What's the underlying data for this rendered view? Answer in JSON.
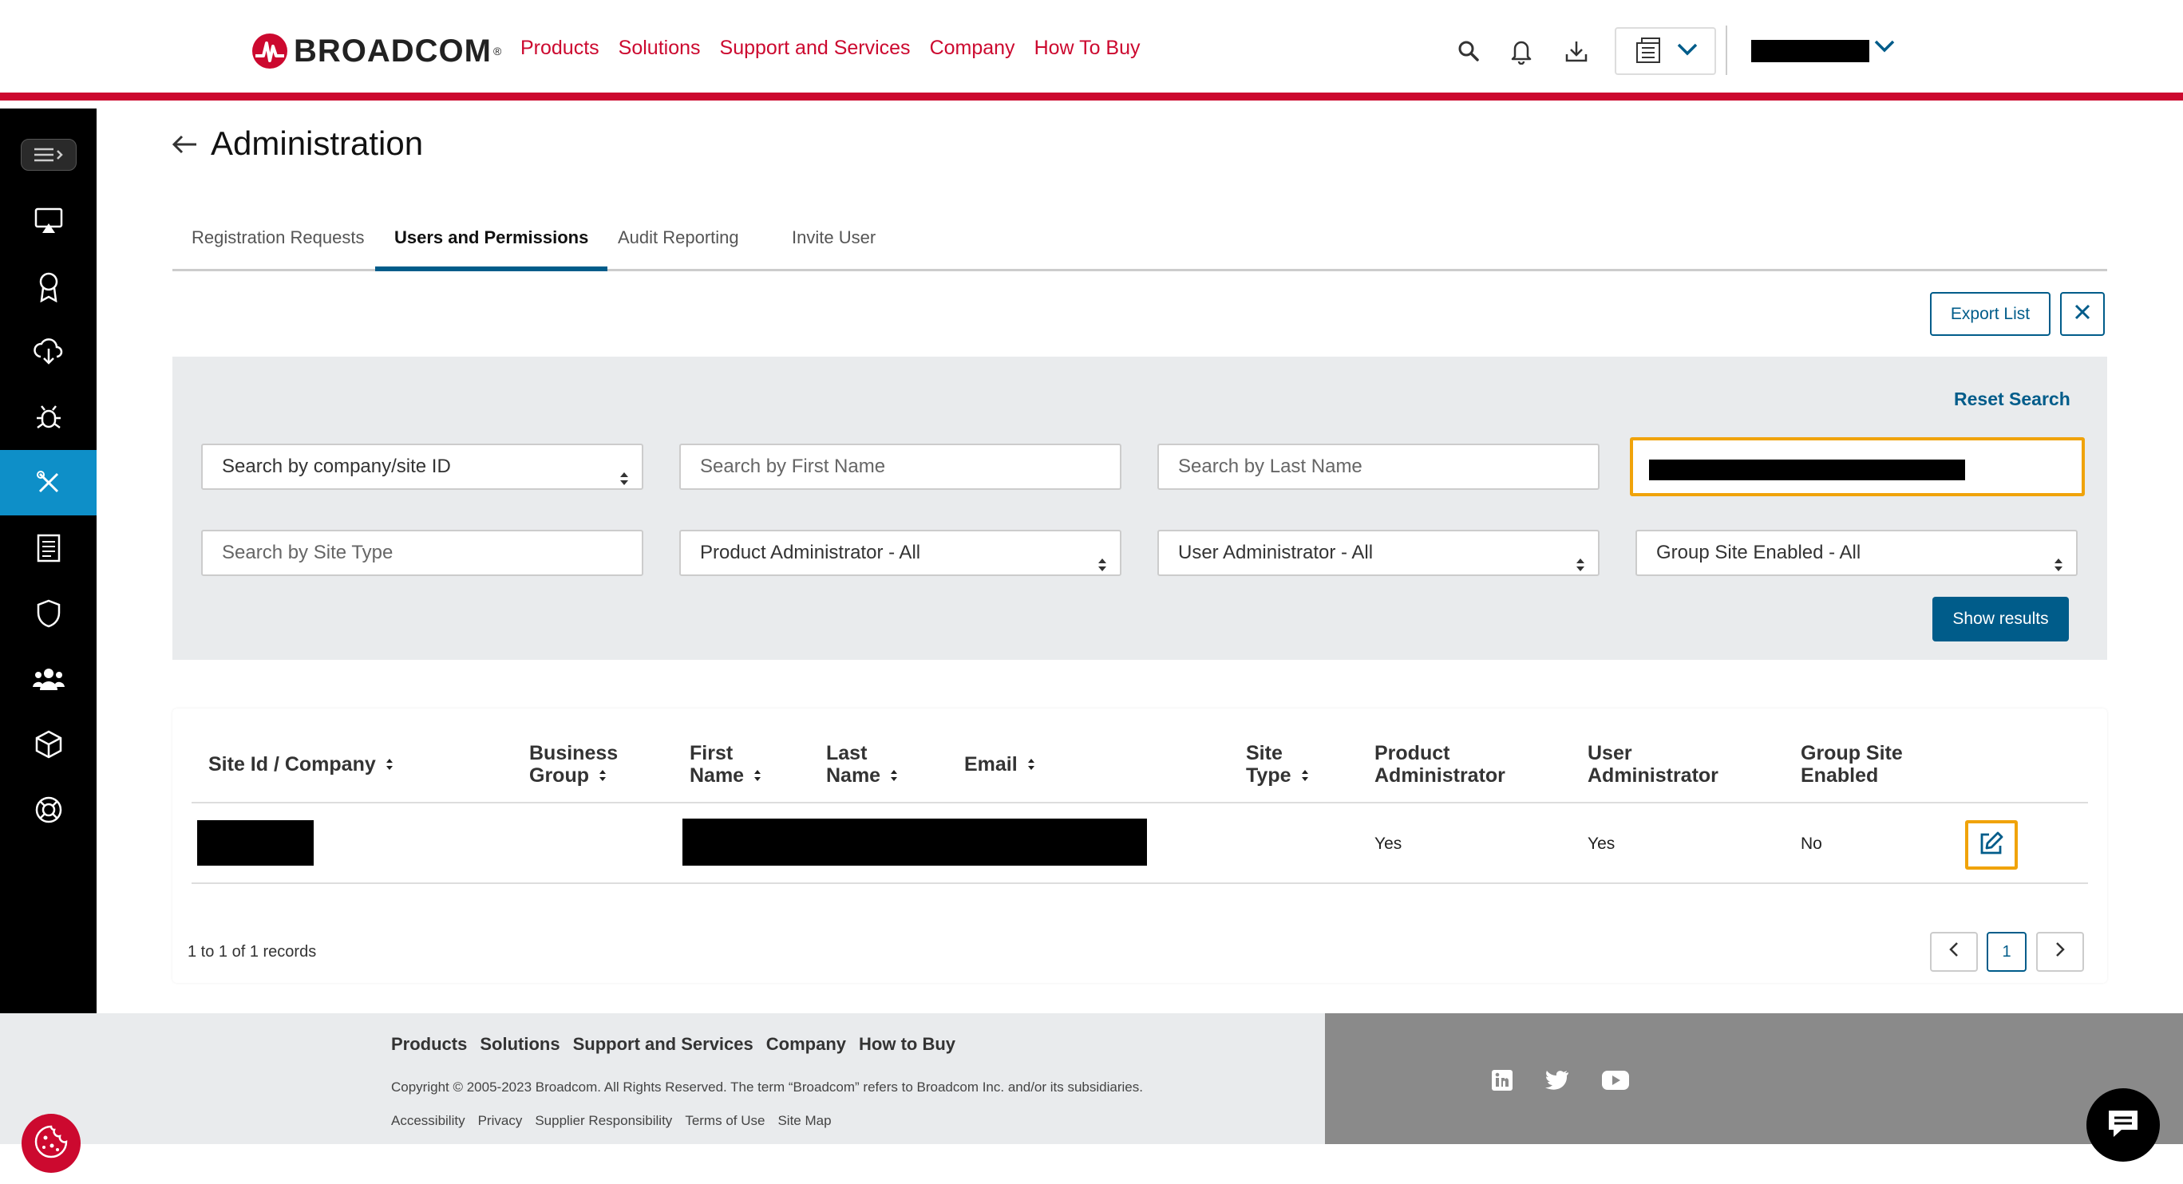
{
  "brand": {
    "name": "BROADCOM",
    "reg": "®",
    "accent": "#cc092f",
    "primary": "#005c8a"
  },
  "nav": [
    "Products",
    "Solutions",
    "Support and Services",
    "Company",
    "How To Buy"
  ],
  "header_icons": [
    "search-icon",
    "bell-icon",
    "download-icon",
    "apps-icon",
    "chevron-down-icon"
  ],
  "sidebar_icons": [
    "menu-toggle-icon",
    "monitor-icon",
    "award-icon",
    "cloud-download-icon",
    "bug-icon",
    "tools-icon",
    "documents-icon",
    "shield-icon",
    "users-icon",
    "cube-icon",
    "lifebuoy-icon"
  ],
  "page": {
    "title": "Administration"
  },
  "tabs": [
    "Registration Requests",
    "Users and Permissions",
    "Audit Reporting",
    "Invite User"
  ],
  "actions": {
    "export": "Export List",
    "reset": "Reset Search",
    "show_results": "Show results"
  },
  "search": {
    "company_select": "Search by company/site ID",
    "first_name_placeholder": "Search by First Name",
    "last_name_placeholder": "Search by Last Name",
    "site_type_placeholder": "Search by Site Type",
    "product_admin_select": "Product Administrator - All",
    "user_admin_select": "User Administrator - All",
    "group_site_select": "Group Site Enabled - All"
  },
  "table": {
    "headers": {
      "site": "Site Id / Company",
      "business_group": [
        "Business",
        "Group"
      ],
      "first_name": [
        "First",
        "Name"
      ],
      "last_name": [
        "Last",
        "Name"
      ],
      "email": "Email",
      "site_type": [
        "Site",
        "Type"
      ],
      "product_admin": [
        "Product",
        "Administrator"
      ],
      "user_admin": [
        "User",
        "Administrator"
      ],
      "group_site": [
        "Group Site",
        "Enabled"
      ]
    },
    "rows": [
      {
        "product_admin": "Yes",
        "user_admin": "Yes",
        "group_site": "No"
      }
    ]
  },
  "pagination": {
    "summary": "1 to 1 of 1 records",
    "current": "1"
  },
  "footer": {
    "links": [
      "Products",
      "Solutions",
      "Support and Services",
      "Company",
      "How to Buy"
    ],
    "copyright": "Copyright © 2005-2023 Broadcom. All Rights Reserved. The term “Broadcom” refers to Broadcom Inc. and/or its subsidiaries.",
    "legal": [
      "Accessibility",
      "Privacy",
      "Supplier Responsibility",
      "Terms of Use",
      "Site Map"
    ],
    "social": [
      "linkedin-icon",
      "twitter-icon",
      "youtube-icon"
    ]
  }
}
